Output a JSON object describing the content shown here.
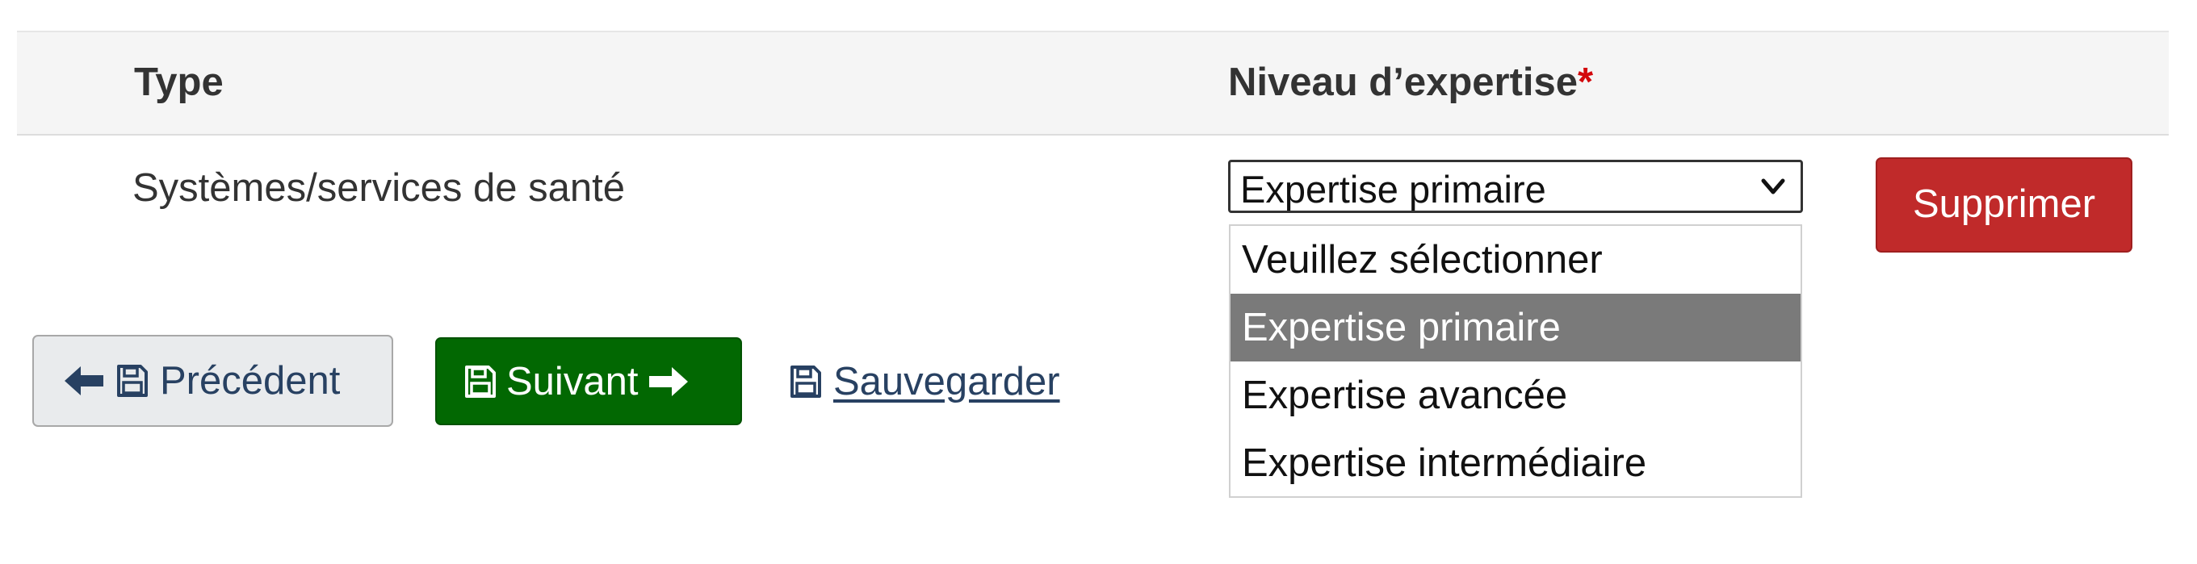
{
  "table": {
    "header": {
      "type_label": "Type",
      "level_label": "Niveau d’expertise",
      "required_marker": "*"
    },
    "rows": [
      {
        "type": "Systèmes/services de santé",
        "level_selected": "Expertise primaire",
        "delete_label": "Supprimer"
      }
    ]
  },
  "dropdown": {
    "options": [
      "Veuillez sélectionner",
      "Expertise primaire",
      "Expertise avancée",
      "Expertise intermédiaire"
    ],
    "highlighted_option": "Expertise primaire"
  },
  "navigation": {
    "previous_label": "Précédent",
    "next_label": "Suivant",
    "save_label": "Sauvegarder"
  },
  "icons": {
    "previous_arrow": "arrow-left-icon",
    "next_arrow": "arrow-right-icon",
    "save": "floppy-disk-icon",
    "select_chevron": "chevron-down-icon"
  },
  "colors": {
    "required": "#d3080c",
    "delete_button": "#c02a2a",
    "next_button": "#026802",
    "previous_button": "#e9ebed",
    "link": "#284162",
    "highlighted_option": "#7a7a7a"
  }
}
